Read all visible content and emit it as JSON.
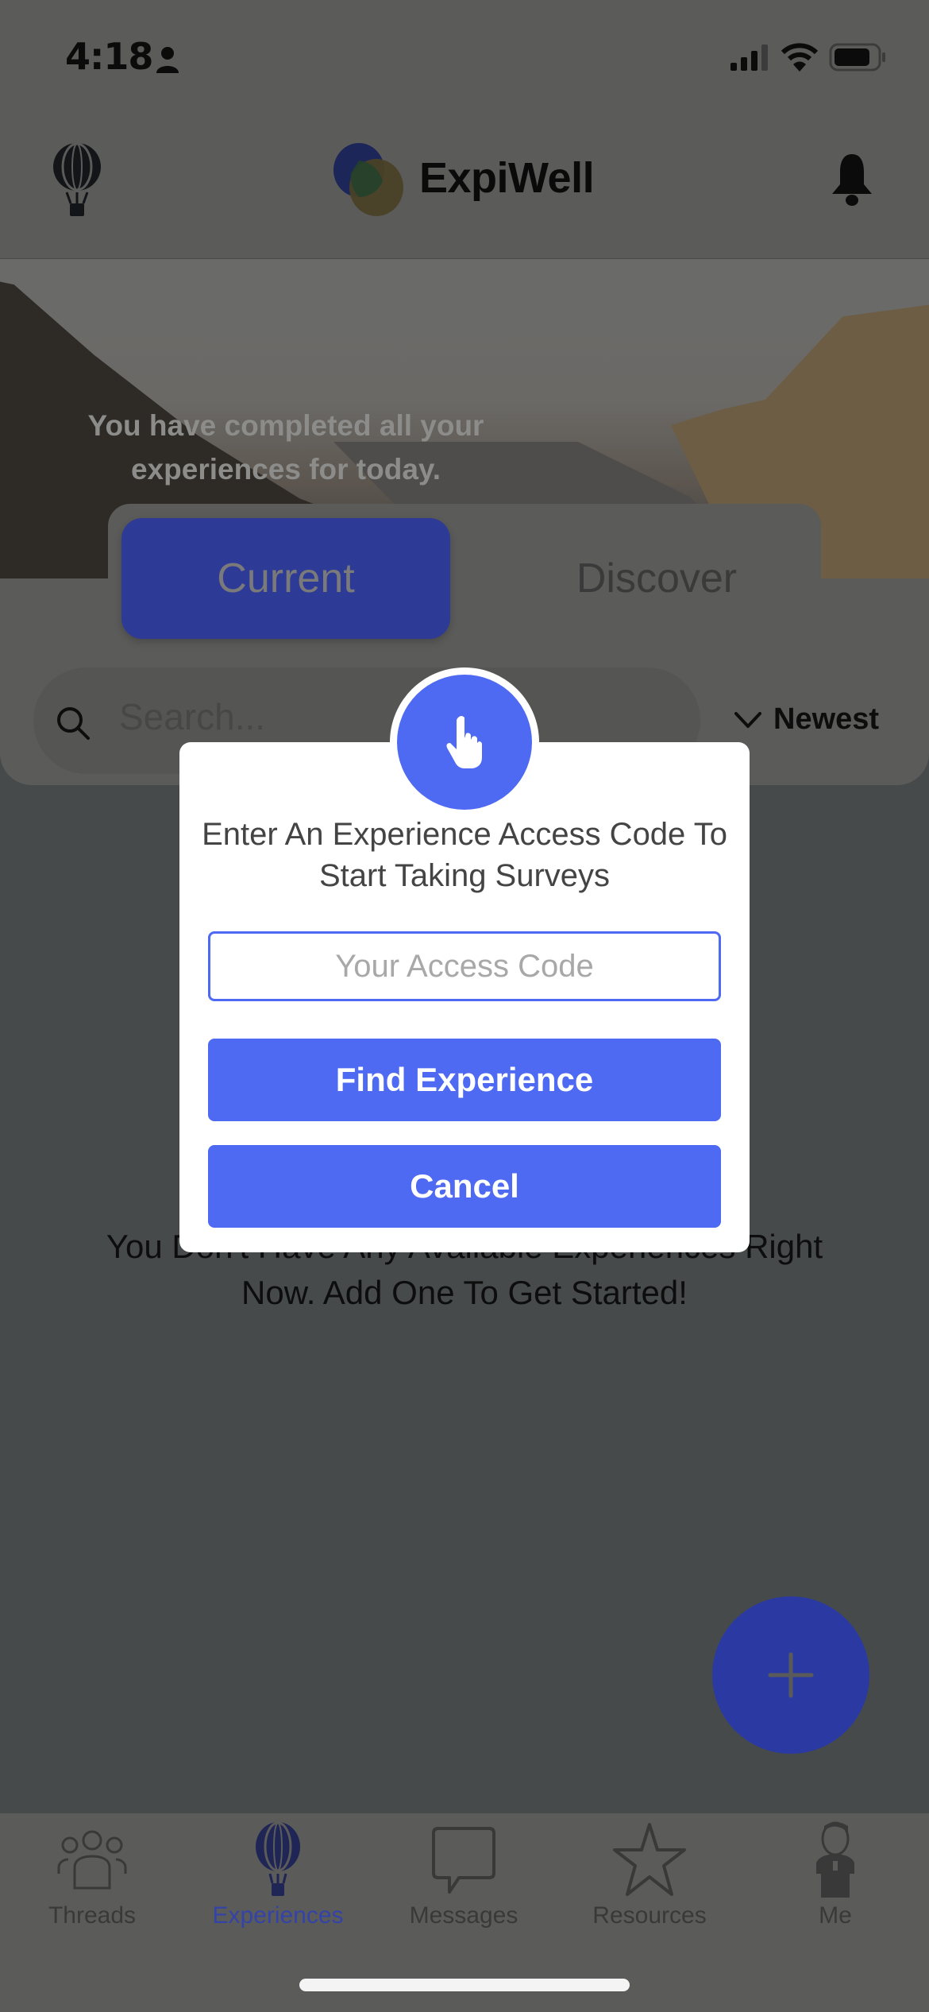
{
  "status_bar": {
    "time": "4:18",
    "icons": [
      "person-icon",
      "cellular-signal-icon",
      "wifi-icon",
      "battery-icon"
    ]
  },
  "header": {
    "left_icon": "hot-air-balloon-icon",
    "app_name": "ExpiWell",
    "right_icon": "bell-icon"
  },
  "hero": {
    "message": "You have completed all your experiences for today."
  },
  "segmented_tabs": [
    {
      "label": "Current",
      "active": true
    },
    {
      "label": "Discover",
      "active": false
    }
  ],
  "search": {
    "placeholder": "Search..."
  },
  "sort": {
    "label": "Newest",
    "icon": "chevron-down-icon"
  },
  "empty_state": {
    "message": "You Don't Have Any Available Experiences Right Now. Add One To Get Started!"
  },
  "fab": {
    "icon": "plus-icon"
  },
  "modal": {
    "icon": "pointing-hand-icon",
    "title": "Enter An Experience Access Code To Start Taking Surveys",
    "input_placeholder": "Your Access Code",
    "input_value": "",
    "primary_button": "Find Experience",
    "secondary_button": "Cancel",
    "accent_color": "#4e69f2"
  },
  "bottom_nav": [
    {
      "label": "Threads",
      "icon": "users-group-icon",
      "active": false
    },
    {
      "label": "Experiences",
      "icon": "hot-air-balloon-icon",
      "active": true
    },
    {
      "label": "Messages",
      "icon": "speech-bubble-icon",
      "active": false
    },
    {
      "label": "Resources",
      "icon": "star-icon",
      "active": false
    },
    {
      "label": "Me",
      "icon": "person-avatar-icon",
      "active": false
    }
  ]
}
